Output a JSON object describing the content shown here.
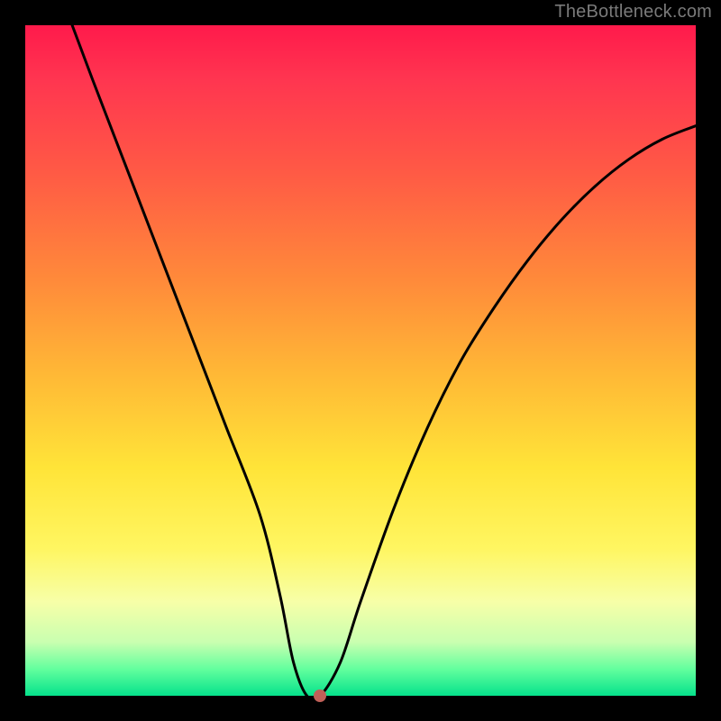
{
  "watermark": "TheBottleneck.com",
  "chart_data": {
    "type": "line",
    "title": "",
    "xlabel": "",
    "ylabel": "",
    "xlim": [
      0,
      100
    ],
    "ylim": [
      0,
      100
    ],
    "series": [
      {
        "name": "curve",
        "x": [
          7,
          10,
          15,
          20,
          25,
          30,
          35,
          38,
          40,
          42,
          44,
          47,
          50,
          55,
          60,
          65,
          70,
          75,
          80,
          85,
          90,
          95,
          100
        ],
        "y": [
          100,
          92,
          79,
          66,
          53,
          40,
          27,
          15,
          5,
          0,
          0,
          5,
          14,
          28,
          40,
          50,
          58,
          65,
          71,
          76,
          80,
          83,
          85
        ]
      }
    ],
    "marker": {
      "x": 44,
      "y": 0,
      "color": "#c06058"
    },
    "background_gradient": {
      "top": "#ff1a4b",
      "mid": "#ffe438",
      "bottom": "#05e28b"
    }
  }
}
